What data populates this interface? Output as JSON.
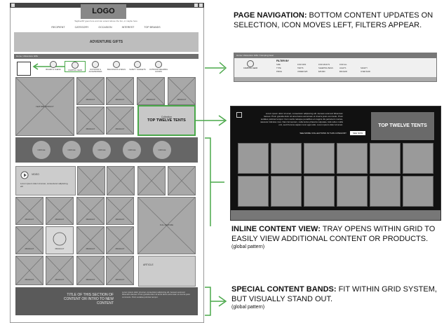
{
  "wireframe": {
    "logo": "LOGO",
    "tagline": "Tagline/AP goes here and can extend above the fun, or maybe here",
    "nav": [
      "RECIPIENT",
      "CATEGORY",
      "OCCASION",
      "INTEREST",
      "TOP BRANDS"
    ],
    "hero": "ADVENTURE GIFTS",
    "breadcrumb": "Home / Adventure Gifts",
    "categories": [
      {
        "label": "BOARD & CHESS"
      },
      {
        "label": "CAMPING GEAR"
      },
      {
        "label": "OUTDOOR & ACCESSORIES"
      },
      {
        "label": "BACKPACKS & BAGS"
      },
      {
        "label": "SAFETY GADGETS"
      },
      {
        "label": "OUTDOOR WEARING GOODS"
      }
    ],
    "feature_product": "FEATURE PRODUCT",
    "product": "PRODUCT",
    "callout": {
      "small": "Collection",
      "title": "TOP TWELVE TENTS"
    },
    "circles": [
      "CIRCLE",
      "CIRCLE",
      "CIRCLE",
      "CIRCLE",
      "CIRCLE"
    ],
    "video": {
      "label": "VIDEO",
      "text": "Lorem ipsum dolor sit amet, consectetur adipiscing elit"
    },
    "full_feature": "FULL FEATURE",
    "article": "ARTICLE",
    "band": {
      "title": "TITLE OF THIS SECTION OF CONTENT OR INTRO TO NEW CONTENT",
      "body": "Lorem ipsum dolor sit amet, consectetur adipiscing elit. Aenean euismod bibendum laoreet. Proin gravida dolor sit amet lacus accumsan et viverra justo commodo. Proin sodales pulvinar tempor."
    }
  },
  "annotations": [
    {
      "bold": "PAGE NAVIGATION:",
      "text": " BOTTOM CONTENT UPDATES ON SELECTION, ICON MOVES LEFT, FILTERS APPEAR.",
      "note": ""
    },
    {
      "bold": "INLINE CONTENT VIEW:",
      "text": " TRAY OPENS WITHIN GRID TO EASILY VIEW ADDITIONAL CONTENT OR PRODUCTS.",
      "note": "(global pattern)"
    },
    {
      "bold": "SPECIAL CONTENT BANDS:",
      "text": " FIT WITHIN GRID SYSTEM, BUT VISUALLY STAND OUT.",
      "note": "(global pattern)"
    }
  ],
  "panel_nav": {
    "breadcrumb": "Home / Adventure Gifts / Camping Gear",
    "filter_title": "FILTER BY",
    "icon_label": "CAMPING GEAR",
    "filters": [
      "SIZE",
      "TYPE",
      "PRICE",
      "FOR KIDS",
      "FOR ADULTS",
      "FOR ALL",
      "TENTS",
      "SLEEPING BAGS",
      "LIGHTS",
      "UNDER $25",
      "$25-$50",
      "$50-$100",
      "SAFETY",
      "OTHER GEAR",
      "OVER $100"
    ]
  },
  "panel_tray": {
    "text": "Lorem ipsum dolor sit amet, consectetur adipiscing elit. Aenean euismod bibendum laoreet. Proin gravida dolor sit amet lacus accumsan et viverra justo commodo. Proin sodales pulvinar tempor. Cum sociis natoque penatibus et magnis dis parturient montes, nascetur ridiculus mus. Nam fermentum, nulla luctus pharetra vulputate, felis tellus mollis orci, sed rhoncus sapien nunc eget odio. Lorem ipsum dolor sit amet.",
    "see_more": "SEE MORE COLLECTIONS IN THIS CATEGORY",
    "shop_btn": "SEE NOW",
    "title": "TOP TWELVE TENTS"
  },
  "colors": {
    "accent": "#4aa84a",
    "dark": "#5a5a5a",
    "tray": "#111111"
  }
}
